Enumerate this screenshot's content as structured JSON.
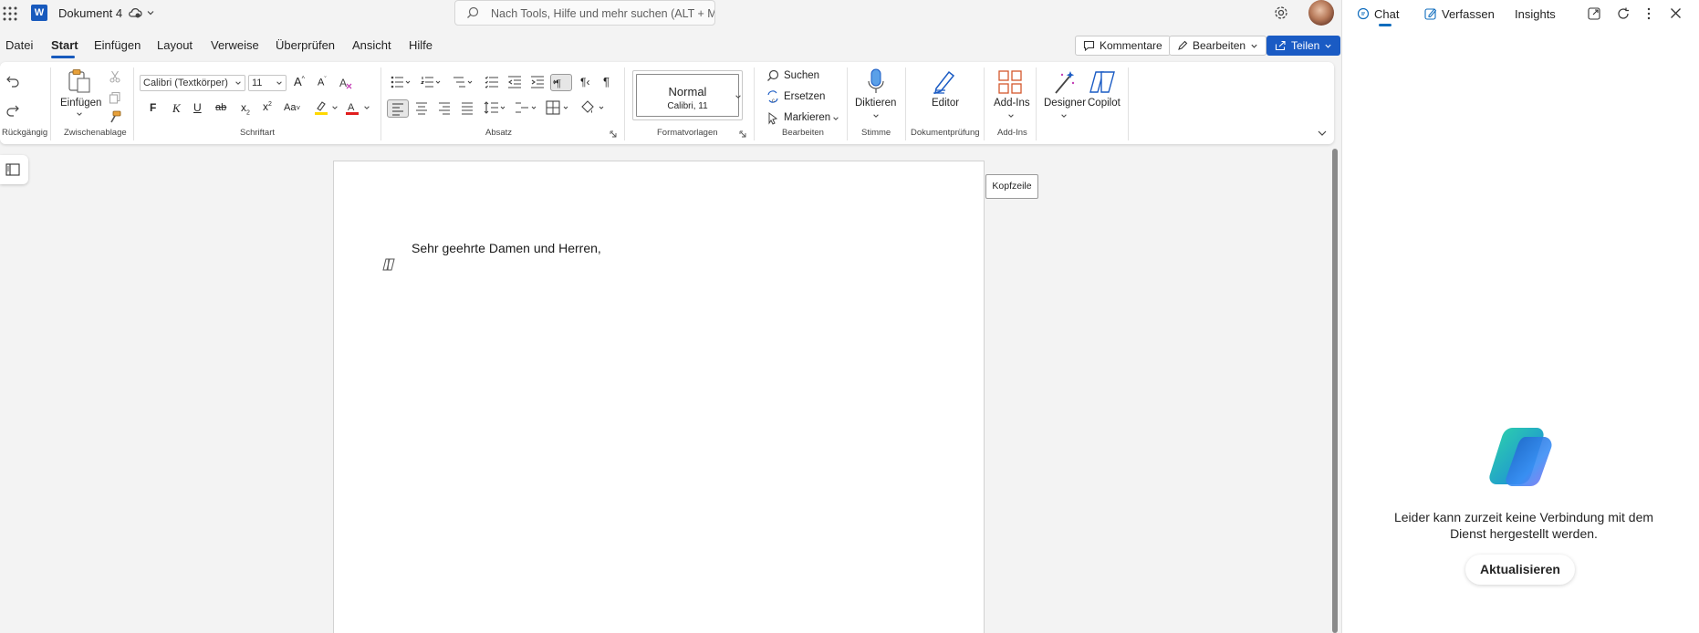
{
  "titlebar": {
    "doc_title": "Dokument 4",
    "search_placeholder": "Nach Tools, Hilfe und mehr suchen (ALT + M"
  },
  "tabs": [
    "Datei",
    "Start",
    "Einfügen",
    "Layout",
    "Verweise",
    "Überprüfen",
    "Ansicht",
    "Hilfe"
  ],
  "active_tab": "Start",
  "top_buttons": {
    "comments": "Kommentare",
    "edit": "Bearbeiten",
    "share": "Teilen"
  },
  "ribbon": {
    "groups": {
      "undo": "Rückgängig",
      "clipboard": "Zwischenablage",
      "font": "Schriftart",
      "paragraph": "Absatz",
      "styles": "Formatvorlagen",
      "editing": "Bearbeiten",
      "voice": "Stimme",
      "proofing": "Dokumentprüfung",
      "addins": "Add-Ins"
    },
    "paste_label": "Einfügen",
    "font_name": "Calibri (Textkörper)",
    "font_size": "11",
    "style_name": "Normal",
    "style_sub": "Calibri, 11",
    "find": "Suchen",
    "replace": "Ersetzen",
    "select": "Markieren",
    "dictate": "Diktieren",
    "editor": "Editor",
    "addins": "Add-Ins",
    "designer": "Designer",
    "copilot": "Copilot",
    "bold": "F",
    "italic": "K",
    "underline": "U",
    "strike": "ab",
    "change_case": "Aa"
  },
  "document": {
    "greeting": "Sehr geehrte Damen und Herren,",
    "header_tooltip": "Kopfzeile"
  },
  "side_pane": {
    "tabs": [
      "Chat",
      "Verfassen",
      "Insights"
    ],
    "error_message": "Leider kann zurzeit keine Verbindung mit dem Dienst hergestellt werden.",
    "refresh_button": "Aktualisieren"
  },
  "colors": {
    "accent": "#185abd",
    "share_button": "#1a5bc4",
    "highlight": "#ffd800",
    "font_color": "#e01e1e"
  }
}
